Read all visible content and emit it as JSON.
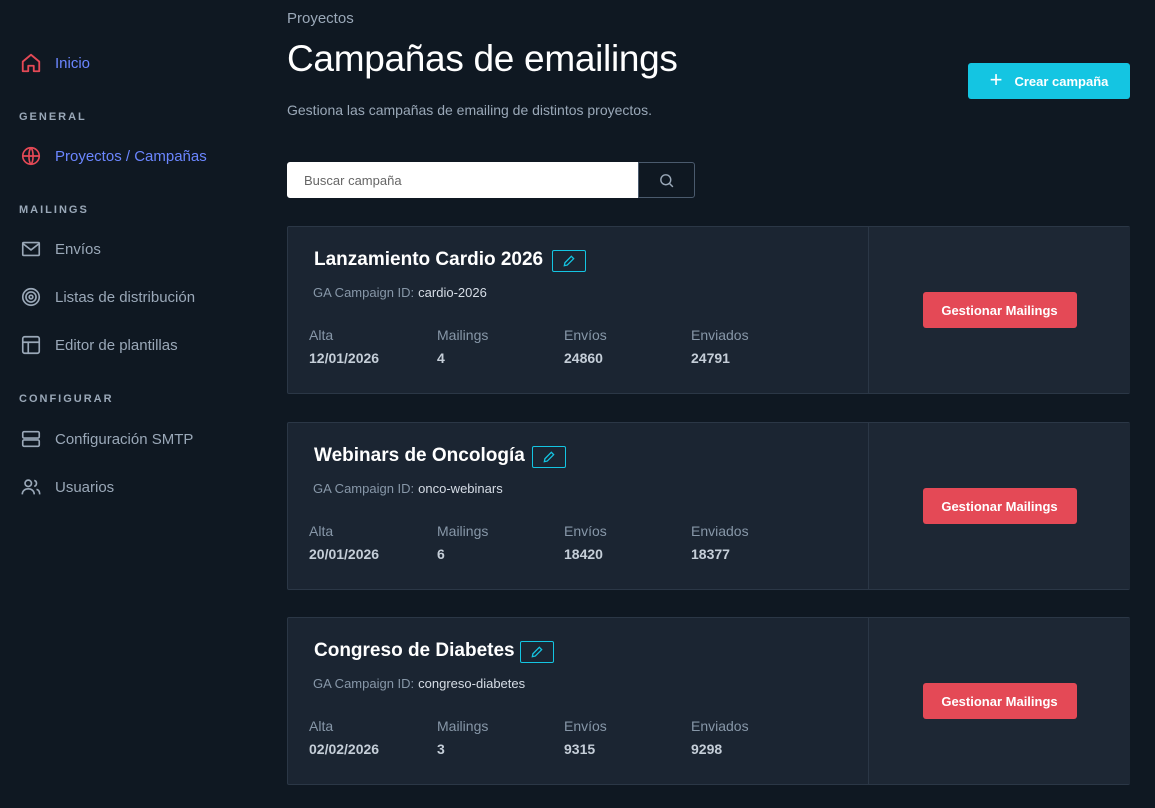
{
  "sidebar": {
    "home": "Inicio",
    "sections": {
      "general": "GENERAL",
      "mailings": "MAILINGS",
      "config": "CONFIGURAR"
    },
    "items": {
      "projects": "Proyectos / Campañas",
      "sends": "Envíos",
      "lists": "Listas de distribución",
      "templates": "Editor de plantillas",
      "smtp": "Configuración SMTP",
      "users": "Usuarios"
    },
    "icons": {
      "home": "home-icon",
      "projects": "globe-icon",
      "sends": "mail-icon",
      "lists": "target-icon",
      "templates": "layout-icon",
      "smtp": "server-icon",
      "users": "users-icon"
    },
    "colors": {
      "active": "#6b86ff",
      "home_icon": "#e44956"
    }
  },
  "header": {
    "breadcrumb": "Proyectos",
    "title": "Campañas de emailings",
    "subtitle": "Gestiona las campañas de emailing de distintos proyectos.",
    "create_label": "Crear campaña"
  },
  "search": {
    "placeholder": "Buscar campaña",
    "value": ""
  },
  "stat_labels": {
    "alta": "Alta",
    "mailings": "Mailings",
    "envios": "Envíos",
    "enviados": "Enviados"
  },
  "ga_label": "GA Campaign ID:",
  "manage_label": "Gestionar Mailings",
  "campaigns": [
    {
      "name": "Lanzamiento Cardio 2026",
      "ga_id": "cardio-2026",
      "alta": "12/01/2026",
      "mailings": "4",
      "envios": "24860",
      "enviados": "24791"
    },
    {
      "name": "Webinars de Oncología",
      "ga_id": "onco-webinars",
      "alta": "20/01/2026",
      "mailings": "6",
      "envios": "18420",
      "enviados": "18377"
    },
    {
      "name": "Congreso de Diabetes",
      "ga_id": "congreso-diabetes",
      "alta": "02/02/2026",
      "mailings": "3",
      "envios": "9315",
      "enviados": "9298"
    }
  ],
  "colors": {
    "accent": "#14c5e2",
    "danger": "#e44956",
    "background": "#0f1822",
    "card": "#1b2532"
  }
}
